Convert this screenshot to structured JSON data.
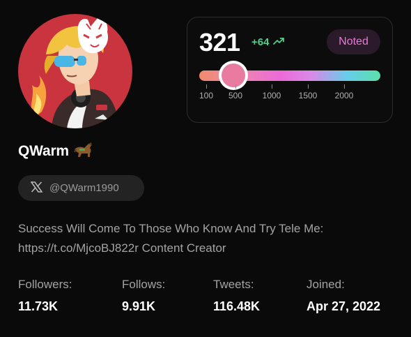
{
  "profile": {
    "display_name": "QWarm",
    "name_emoji": "🐎",
    "handle": "@QWarm1990",
    "bio": "Success Will Come To Those Who Know And Try Tele Me: https://t.co/MjcoBJ822r Content Creator",
    "avatar_icon": "anime-avatar-fox-mask"
  },
  "stats": [
    {
      "label": "Followers:",
      "value": "11.73K"
    },
    {
      "label": "Follows:",
      "value": "9.91K"
    },
    {
      "label": "Tweets:",
      "value": "116.48K"
    },
    {
      "label": "Joined:",
      "value": "Apr 27, 2022"
    }
  ],
  "score": {
    "value": "321",
    "delta": "+64",
    "delta_icon": "trending-up-icon",
    "badge": "Noted",
    "slider_value": 321,
    "ticks": [
      "100",
      "500",
      "1000",
      "1500",
      "2000"
    ]
  },
  "colors": {
    "background": "#0a0a0a",
    "delta_green": "#4fd08a",
    "badge_pink": "#e87ad6",
    "avatar_red": "#c9343f"
  }
}
